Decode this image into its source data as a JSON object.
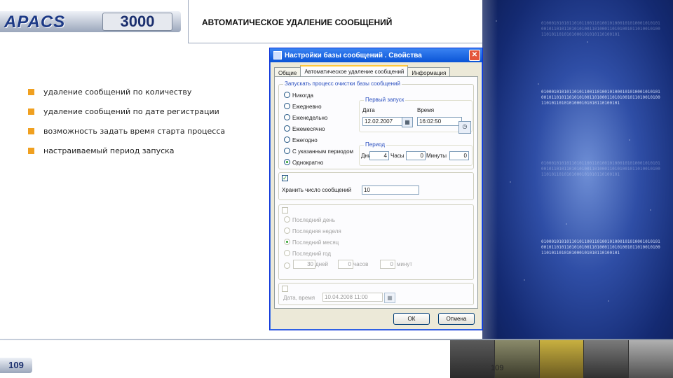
{
  "header": {
    "logo_text": "APACS",
    "logo_number": "3000",
    "title": "АВТОМАТИЧЕСКОЕ УДАЛЕНИЕ СООБЩЕНИЙ"
  },
  "bullets": [
    "удаление сообщений по количеству",
    "удаление сообщений по дате регистрации",
    "возможность задать время старта процесса",
    "настраиваемый период запуска"
  ],
  "dialog": {
    "title": "Настройки базы сообщений . Свойства",
    "close_glyph": "✕",
    "tabs": [
      "Общие",
      "Автоматическое удаление сообщений",
      "Информация"
    ],
    "schedule_group_label": "Запускать процесс очистки базы сообщений",
    "schedule_options": [
      "Никогда",
      "Ежедневно",
      "Еженедельно",
      "Ежемесячно",
      "Ежегодно",
      "С указанным периодом",
      "Однократно"
    ],
    "schedule_selected": "Однократно",
    "first_run_label": "Первый запуск",
    "date_label": "Дата",
    "date_value": "12.02.2007",
    "time_label": "Время",
    "time_value": "16:02:50",
    "period_label": "Период",
    "days_label": "Дни",
    "days_value": "4",
    "hours_label": "Часы",
    "hours_value": "0",
    "minutes_label": "Минуты",
    "minutes_value": "0",
    "count_checked_mark": "✓",
    "keep_count_label": "Хранить число сообщений",
    "keep_count_value": "10",
    "period_options": [
      "Последний день",
      "Последняя неделя",
      "Последний месяц",
      "Последний год"
    ],
    "period_selected": "Последний месяц",
    "custom_days_value": "30",
    "custom_days_label": "дней",
    "custom_hours_value": "0",
    "custom_hours_label": "часов",
    "custom_minutes_value": "0",
    "custom_minutes_label": "минут",
    "datetime_label": "Дата, время",
    "datetime_value": "10.04.2008 11:00",
    "ok_label": "ОК",
    "cancel_label": "Отмена"
  },
  "footer": {
    "page_badge": "109",
    "page_number": "109"
  },
  "binary_text": "01000101010110101100110100101000101010001010101001011010110101010011010001101010010110100101001101011010101000101010110100101"
}
